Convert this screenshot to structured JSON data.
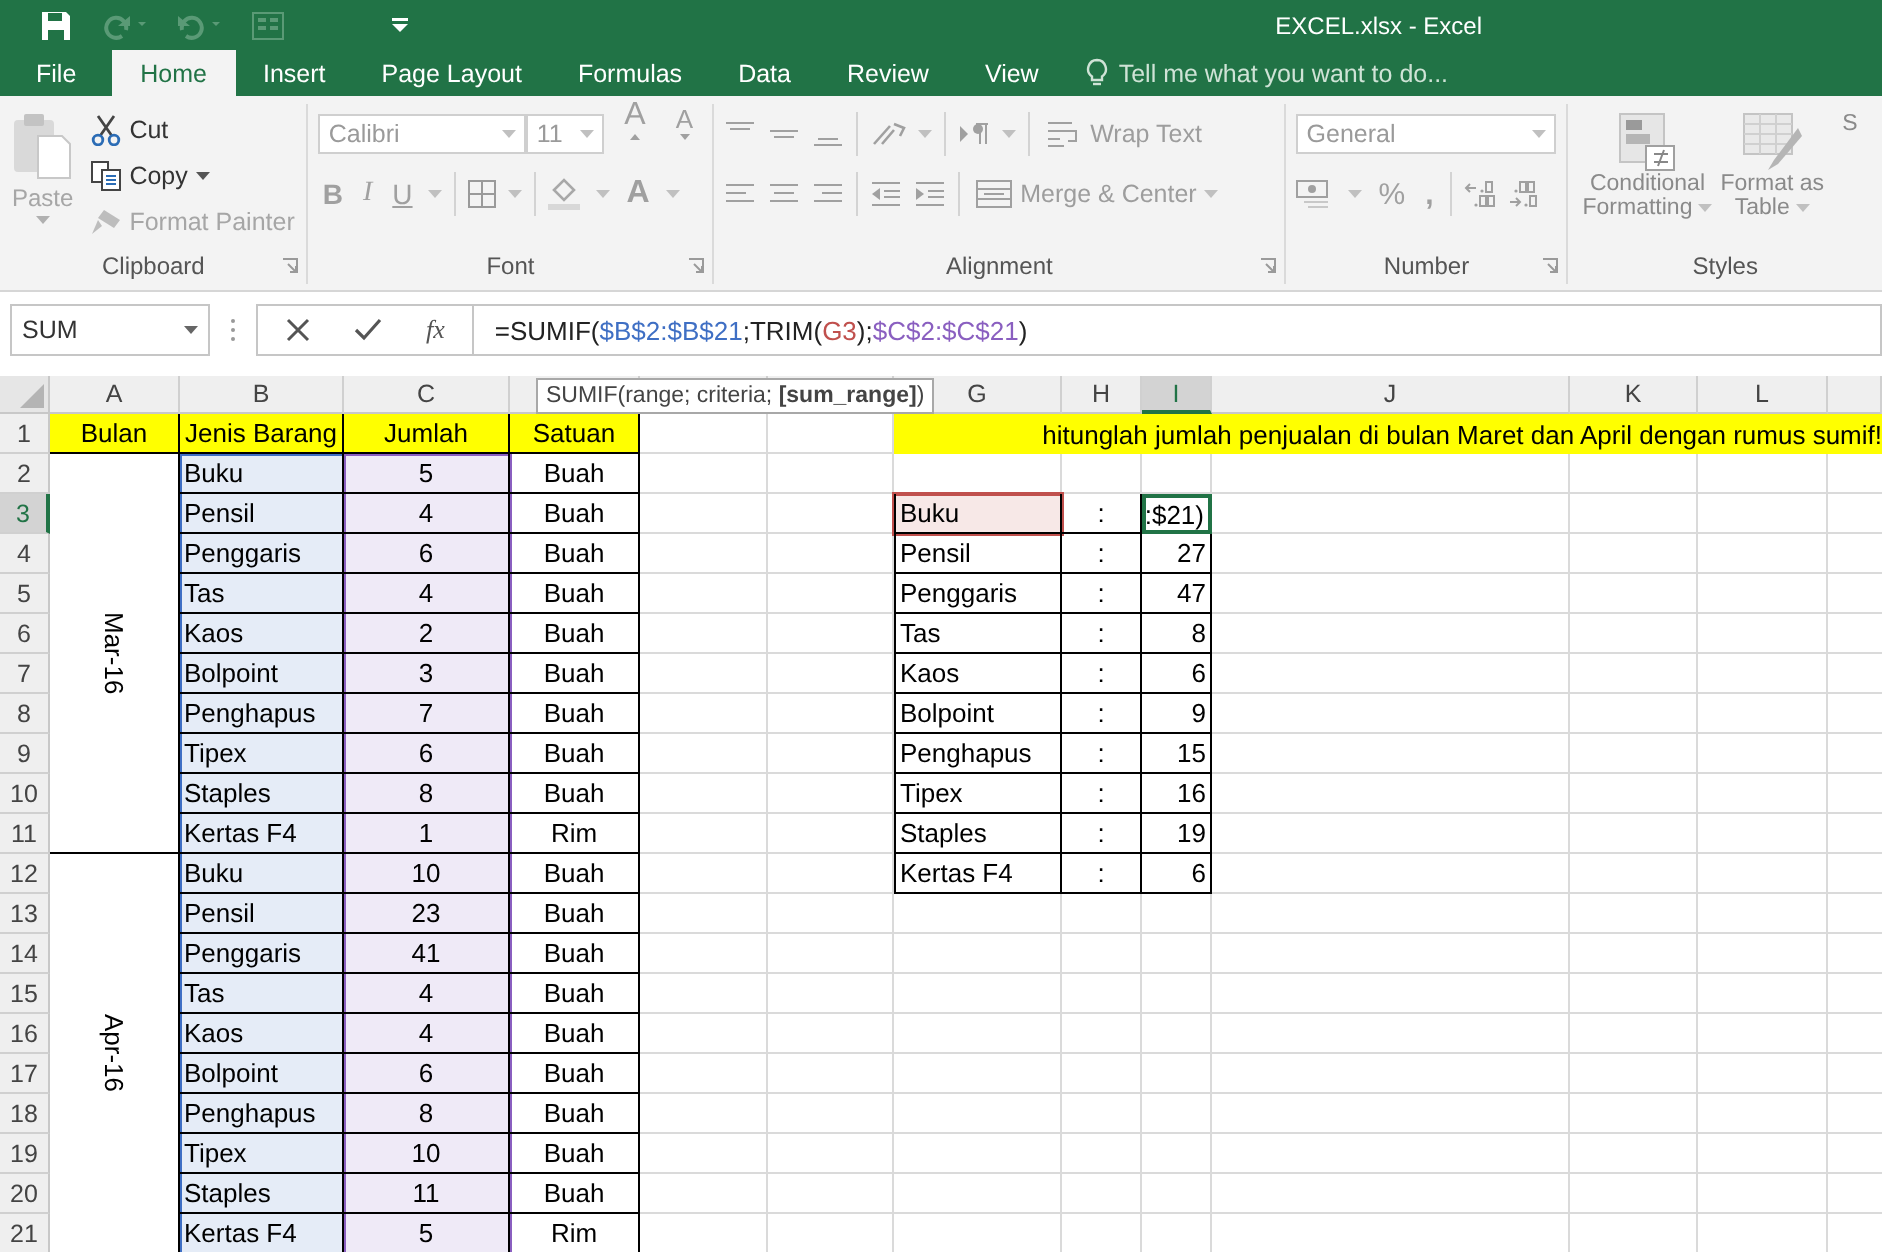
{
  "window": {
    "title": "EXCEL.xlsx - Excel"
  },
  "tabs": [
    {
      "label": "File",
      "selected": false
    },
    {
      "label": "Home",
      "selected": true
    },
    {
      "label": "Insert",
      "selected": false
    },
    {
      "label": "Page Layout",
      "selected": false
    },
    {
      "label": "Formulas",
      "selected": false
    },
    {
      "label": "Data",
      "selected": false
    },
    {
      "label": "Review",
      "selected": false
    },
    {
      "label": "View",
      "selected": false
    }
  ],
  "tell_me": {
    "placeholder": "Tell me what you want to do..."
  },
  "ribbon": {
    "clipboard": {
      "label": "Clipboard",
      "paste": {
        "label": "Paste",
        "disabled": true
      },
      "cut": {
        "label": "Cut",
        "disabled": false
      },
      "copy": {
        "label": "Copy",
        "disabled": false
      },
      "format_painter": {
        "label": "Format Painter",
        "disabled": true
      }
    },
    "font": {
      "label": "Font",
      "font_name": "Calibri",
      "font_size": "11",
      "grow": "A",
      "shrink": "A",
      "bold": "B",
      "italic": "I",
      "underline": "U",
      "font_color": "A"
    },
    "alignment": {
      "label": "Alignment",
      "wrap_text": "Wrap Text",
      "merge": "Merge & Center"
    },
    "number": {
      "label": "Number",
      "format": "General",
      "percent": "%",
      "comma": ","
    },
    "styles": {
      "label": "Styles",
      "buttons": [
        {
          "line1": "Conditional",
          "line2": "Formatting"
        },
        {
          "line1": "Format as",
          "line2": "Table"
        },
        {
          "line2": "S"
        }
      ]
    }
  },
  "formula_bar": {
    "name_box": "SUM",
    "function_label": "fx",
    "tokens": [
      {
        "text": "=SUMIF("
      },
      {
        "text": "$B$2:$B$21",
        "color": "#3f6fc4"
      },
      {
        "text": ";TRIM("
      },
      {
        "text": "G3",
        "color": "#c0504d"
      },
      {
        "text": ");"
      },
      {
        "text": "$C$2:$C$21",
        "color": "#8a5fc0"
      },
      {
        "text": ")"
      }
    ]
  },
  "tooltip": "SUMIF(range; criteria; **[sum_range]**)",
  "sheet": {
    "columns": [
      {
        "label": "A",
        "selected": false
      },
      {
        "label": "B",
        "selected": false
      },
      {
        "label": "C",
        "selected": false
      },
      {
        "selected": false
      },
      {
        "selected": false
      },
      {
        "selected": false
      },
      {
        "label": "G",
        "selected": false
      },
      {
        "label": "H",
        "selected": false
      },
      {
        "label": "I",
        "selected": true
      },
      {
        "label": "J",
        "selected": false
      },
      {
        "label": "K",
        "selected": false
      },
      {
        "label": "L",
        "selected": false
      },
      {
        "selected": false
      }
    ],
    "rows": [
      {
        "number": "1",
        "selected": false
      },
      {
        "number": "2",
        "selected": false
      },
      {
        "number": "3",
        "selected": true
      },
      {
        "number": "4",
        "selected": false
      },
      {
        "number": "5",
        "selected": false
      },
      {
        "number": "6",
        "selected": false
      },
      {
        "number": "7",
        "selected": false
      },
      {
        "number": "8",
        "selected": false
      },
      {
        "number": "9",
        "selected": false
      },
      {
        "number": "10",
        "selected": false
      },
      {
        "number": "11",
        "selected": false
      },
      {
        "number": "12",
        "selected": false
      },
      {
        "number": "13",
        "selected": false
      },
      {
        "number": "14",
        "selected": false
      },
      {
        "number": "15",
        "selected": false
      },
      {
        "number": "16",
        "selected": false
      },
      {
        "number": "17",
        "selected": false
      },
      {
        "number": "18",
        "selected": false
      },
      {
        "number": "19",
        "selected": false
      },
      {
        "number": "20",
        "selected": false
      },
      {
        "number": "21",
        "selected": false
      }
    ],
    "headers": [
      "Bulan",
      "Jenis Barang",
      "Jumlah",
      "Satuan"
    ],
    "instruction": "hitunglah jumlah penjualan di bulan Maret dan April dengan rumus sumif!",
    "months": [
      {
        "label": "Mar-16",
        "items": [
          {
            "item": "Buku",
            "qty": "5",
            "unit": "Buah"
          },
          {
            "item": "Pensil",
            "qty": "4",
            "unit": "Buah"
          },
          {
            "item": "Penggaris",
            "qty": "6",
            "unit": "Buah"
          },
          {
            "item": "Tas",
            "qty": "4",
            "unit": "Buah"
          },
          {
            "item": "Kaos",
            "qty": "2",
            "unit": "Buah"
          },
          {
            "item": "Bolpoint",
            "qty": "3",
            "unit": "Buah"
          },
          {
            "item": "Penghapus",
            "qty": "7",
            "unit": "Buah"
          },
          {
            "item": "Tipex",
            "qty": "6",
            "unit": "Buah"
          },
          {
            "item": "Staples",
            "qty": "8",
            "unit": "Buah"
          },
          {
            "item": "Kertas F4",
            "qty": "1",
            "unit": "Rim"
          }
        ]
      },
      {
        "label": "Apr-16",
        "items": [
          {
            "item": "Buku",
            "qty": "10",
            "unit": "Buah"
          },
          {
            "item": "Pensil",
            "qty": "23",
            "unit": "Buah"
          },
          {
            "item": "Penggaris",
            "qty": "41",
            "unit": "Buah"
          },
          {
            "item": "Tas",
            "qty": "4",
            "unit": "Buah"
          },
          {
            "item": "Kaos",
            "qty": "4",
            "unit": "Buah"
          },
          {
            "item": "Bolpoint",
            "qty": "6",
            "unit": "Buah"
          },
          {
            "item": "Penghapus",
            "qty": "8",
            "unit": "Buah"
          },
          {
            "item": "Tipex",
            "qty": "10",
            "unit": "Buah"
          },
          {
            "item": "Staples",
            "qty": "11",
            "unit": "Buah"
          },
          {
            "item": "Kertas F4",
            "qty": "5",
            "unit": "Rim"
          }
        ]
      }
    ],
    "summary": [
      {
        "item": "Buku",
        "separator": ":",
        "total": ":$21)",
        "selected": true
      },
      {
        "item": "Pensil",
        "separator": ":",
        "total": "27",
        "selected": false
      },
      {
        "item": "Penggaris",
        "separator": ":",
        "total": "47",
        "selected": false
      },
      {
        "item": "Tas",
        "separator": ":",
        "total": "8",
        "selected": false
      },
      {
        "item": "Kaos",
        "separator": ":",
        "total": "6",
        "selected": false
      },
      {
        "item": "Bolpoint",
        "separator": ":",
        "total": "9",
        "selected": false
      },
      {
        "item": "Penghapus",
        "separator": ":",
        "total": "15",
        "selected": false
      },
      {
        "item": "Tipex",
        "separator": ":",
        "total": "16",
        "selected": false
      },
      {
        "item": "Staples",
        "separator": ":",
        "total": "19",
        "selected": false
      },
      {
        "item": "Kertas F4",
        "separator": ":",
        "total": "6",
        "selected": false
      }
    ]
  }
}
